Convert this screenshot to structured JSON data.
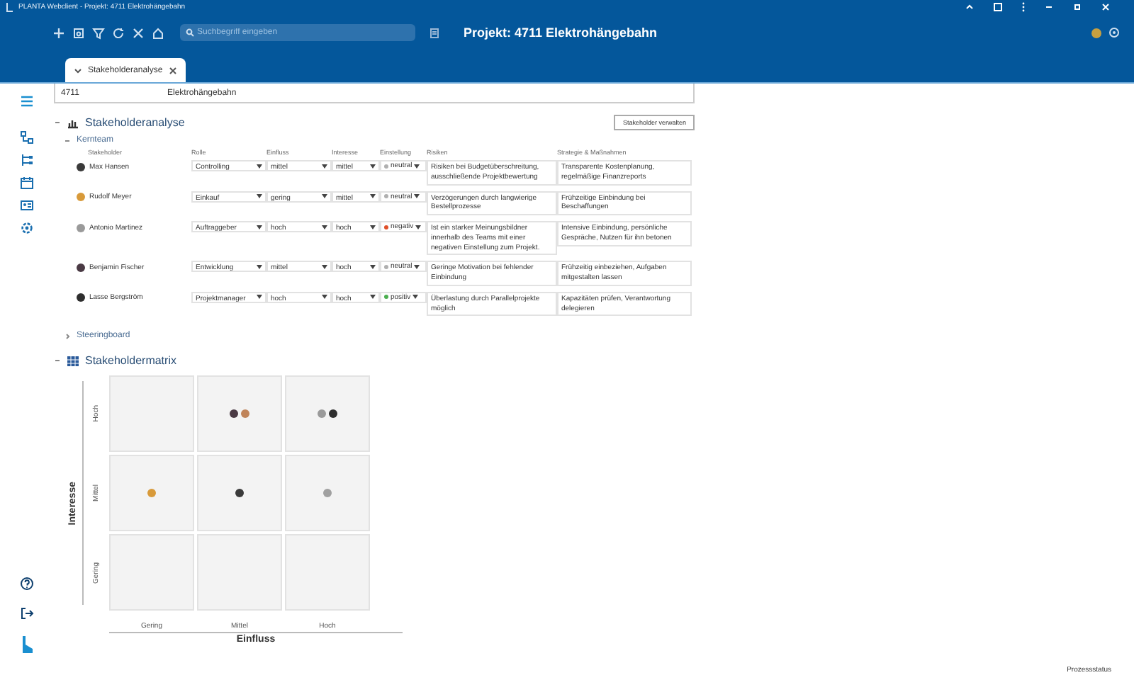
{
  "window": {
    "title": "PLANTA Webclient - Projekt: 4711 Elektrohängebahn"
  },
  "toolbar": {
    "search": {
      "placeholder": "Suchbegriff eingeben"
    },
    "project_title": "Projekt: 4711 Elektrohängebahn"
  },
  "tabs": [
    {
      "label": "Stakeholderanalyse",
      "selected": true
    }
  ],
  "project": {
    "number": "4711",
    "name": "Elektrohängebahn"
  },
  "analysis": {
    "title": "Stakeholderanalyse",
    "expanded": true,
    "manage_button": "Stakeholder verwalten",
    "groups": [
      {
        "title": "Kernteam",
        "expanded": true
      },
      {
        "title": "Steeringboard",
        "expanded": false
      }
    ],
    "columns": [
      "Stakeholder",
      "Rolle",
      "Einfluss",
      "Interesse",
      "Einstellung",
      "Risiken",
      "Strategie & Maßnahmen"
    ],
    "rows": [
      {
        "name": "Max Hansen",
        "avatar": {
          "color": "#3a3a3a"
        },
        "role": "Controlling",
        "influence": "mittel",
        "interest": "mittel",
        "attitude": "neutral",
        "attitude_dot": {
          "color": "#b0b0b0"
        },
        "risks": "Risiken bei Budgetüberschreitung, ausschließende Projektbewertung",
        "strategy": "Transparente Kostenplanung, regelmäßige Finanzreports"
      },
      {
        "name": "Rudolf Meyer",
        "avatar": {
          "color": "#d89a3a"
        },
        "role": "Einkauf",
        "influence": "gering",
        "interest": "mittel",
        "attitude": "neutral",
        "attitude_dot": {
          "color": "#b0b0b0"
        },
        "risks": "Verzögerungen durch langwierige Bestellprozesse",
        "strategy": "Frühzeitige Einbindung bei Beschaffungen"
      },
      {
        "name": "Antonio Martinez",
        "avatar": {
          "color": "#9a9a9a"
        },
        "role": "Auftraggeber",
        "influence": "hoch",
        "interest": "hoch",
        "attitude": "negativ",
        "attitude_dot": {
          "color": "#e0502a"
        },
        "risks": "Ist ein starker Meinungsbildner innerhalb des Teams mit einer negativen Einstellung zum Projekt.",
        "strategy": "Intensive Einbindung, persönliche Gespräche, Nutzen für ihn betonen"
      },
      {
        "name": "Benjamin Fischer",
        "avatar": {
          "color": "#4a3a44"
        },
        "role": "Entwicklung",
        "influence": "mittel",
        "interest": "hoch",
        "attitude": "neutral",
        "attitude_dot": {
          "color": "#b0b0b0"
        },
        "risks": "Geringe Motivation bei fehlender Einbindung",
        "strategy": "Frühzeitig einbeziehen, Aufgaben mitgestalten lassen"
      },
      {
        "name": "Lasse Bergström",
        "avatar": {
          "color": "#2e2e2e"
        },
        "role": "Projektmanager",
        "influence": "hoch",
        "interest": "hoch",
        "attitude": "positiv",
        "attitude_dot": {
          "color": "#4caf50"
        },
        "risks": "Überlastung durch Parallelprojekte möglich",
        "strategy": "Kapazitäten prüfen, Verantwortung delegieren"
      }
    ]
  },
  "matrix": {
    "title": "Stakeholdermatrix",
    "expanded": true,
    "ylabel": "Interesse",
    "xlabel": "Einfluss",
    "row_labels": [
      "Hoch",
      "Mittel",
      "Gering"
    ],
    "col_labels": [
      "Gering",
      "Mittel",
      "Hoch"
    ],
    "cells": [
      [
        [],
        [
          {
            "color": "#4a3a44"
          },
          {
            "color": "#c0845a"
          }
        ],
        [
          {
            "color": "#9a9a9a"
          },
          {
            "color": "#2e2e2e"
          }
        ]
      ],
      [
        [
          {
            "color": "#d89a3a"
          }
        ],
        [
          {
            "color": "#3a3a3a"
          }
        ],
        [
          {
            "color": "#a0a0a0"
          }
        ]
      ],
      [
        [],
        [],
        []
      ]
    ]
  },
  "status_bar": {
    "text": "Prozessstatus"
  }
}
